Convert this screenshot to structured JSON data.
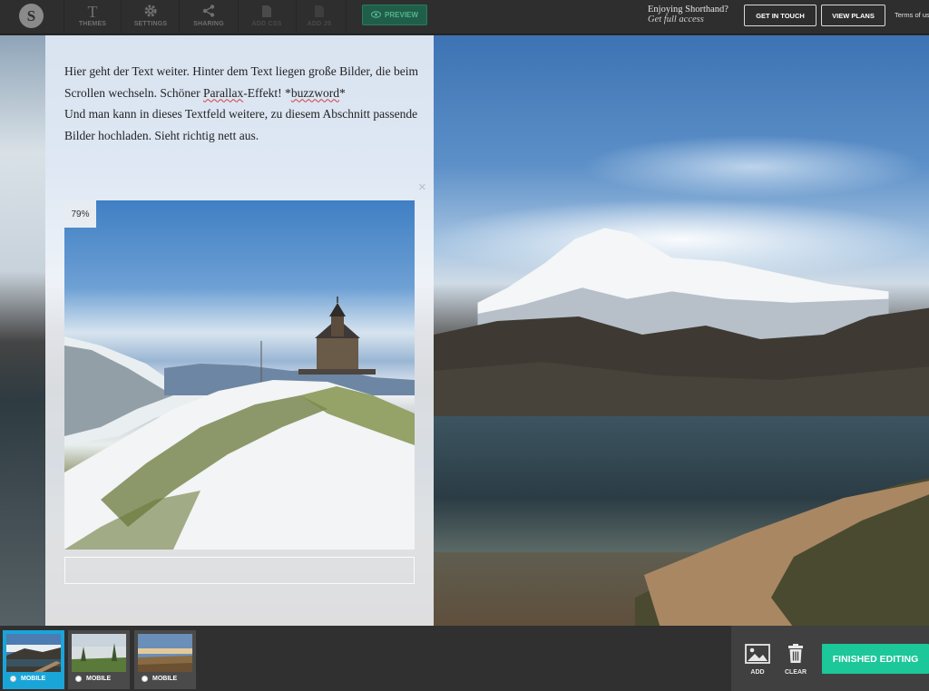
{
  "toolbar": {
    "logo_letter": "S",
    "themes": "THEMES",
    "settings": "SETTINGS",
    "sharing": "SHARING",
    "add_css": "ADD CSS",
    "add_js": "ADD JS",
    "preview": "PREVIEW"
  },
  "promo": {
    "line1": "Enjoying Shorthand?",
    "line2": "Get full access",
    "get_in_touch": "GET IN TOUCH",
    "view_plans": "VIEW PLANS",
    "terms": "Terms of us"
  },
  "content": {
    "p1_a": "Hier geht der Text weiter. Hinter dem Text liegen große Bilder, die beim Scrollen wechseln. Schöner ",
    "p1_spell": "Parallax",
    "p1_b": "-Effekt! *",
    "p1_spell2": "buzzword",
    "p1_c": "*",
    "p2": "Und man kann in dieses Textfeld weitere, zu diesem Abschnitt passende Bilder hochladen. Sieht richtig nett aus.",
    "close": "×",
    "image_percent": "79%"
  },
  "bottom": {
    "thumbs": [
      {
        "label": "MOBILE",
        "selected": true
      },
      {
        "label": "MOBILE",
        "selected": false
      },
      {
        "label": "MOBILE",
        "selected": false
      }
    ],
    "add": "ADD",
    "clear": "CLEAR",
    "finished": "FINISHED EDITING"
  },
  "colors": {
    "accent_green": "#1cc79a",
    "thumb_active": "#1aa5d8",
    "preview_green": "#1f5f49"
  }
}
